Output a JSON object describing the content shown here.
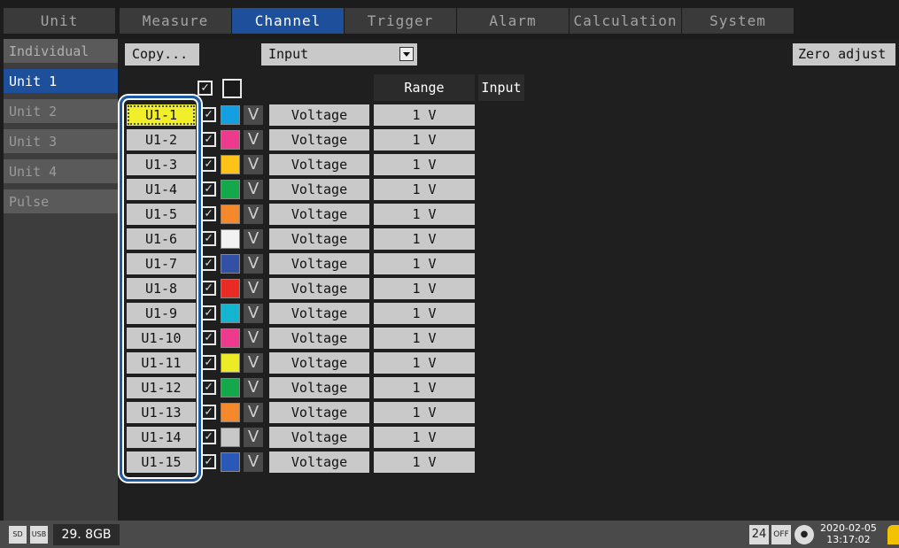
{
  "tabs": [
    "Unit",
    "Measure",
    "Channel",
    "Trigger",
    "Alarm",
    "Calculation",
    "System"
  ],
  "sidebar": [
    "Individual",
    "Unit 1",
    "Unit 2",
    "Unit 3",
    "Unit 4",
    "Pulse"
  ],
  "toolbar": {
    "copy_label": "Copy...",
    "input_select": "Input",
    "zero_adjust_label": "Zero adjust"
  },
  "columns": {
    "range": "Range",
    "input": "Input"
  },
  "rows": [
    {
      "ch": "U1-1",
      "color": "#14a0e0",
      "type": "Voltage",
      "range": "1 V"
    },
    {
      "ch": "U1-2",
      "color": "#ee3a8c",
      "type": "Voltage",
      "range": "1 V"
    },
    {
      "ch": "U1-3",
      "color": "#ffc217",
      "type": "Voltage",
      "range": "1 V"
    },
    {
      "ch": "U1-4",
      "color": "#12a84b",
      "type": "Voltage",
      "range": "1 V"
    },
    {
      "ch": "U1-5",
      "color": "#f5882a",
      "type": "Voltage",
      "range": "1 V"
    },
    {
      "ch": "U1-6",
      "color": "#f2f2f2",
      "type": "Voltage",
      "range": "1 V"
    },
    {
      "ch": "U1-7",
      "color": "#3450a4",
      "type": "Voltage",
      "range": "1 V"
    },
    {
      "ch": "U1-8",
      "color": "#ea2a24",
      "type": "Voltage",
      "range": "1 V"
    },
    {
      "ch": "U1-9",
      "color": "#14b5d0",
      "type": "Voltage",
      "range": "1 V"
    },
    {
      "ch": "U1-10",
      "color": "#ee3a8c",
      "type": "Voltage",
      "range": "1 V"
    },
    {
      "ch": "U1-11",
      "color": "#ecec26",
      "type": "Voltage",
      "range": "1 V"
    },
    {
      "ch": "U1-12",
      "color": "#12a84b",
      "type": "Voltage",
      "range": "1 V"
    },
    {
      "ch": "U1-13",
      "color": "#f5882a",
      "type": "Voltage",
      "range": "1 V"
    },
    {
      "ch": "U1-14",
      "color": "#c8c8c8",
      "type": "Voltage",
      "range": "1 V"
    },
    {
      "ch": "U1-15",
      "color": "#2a58b8",
      "type": "Voltage",
      "range": "1 V"
    }
  ],
  "row_type_icon": "V",
  "status": {
    "memory": "29. 8GB",
    "sd_icon": "SD",
    "usb_icon": "USB",
    "date": "2020-02-05",
    "time": "13:17:02",
    "hours": "24",
    "off_label": "OFF"
  }
}
